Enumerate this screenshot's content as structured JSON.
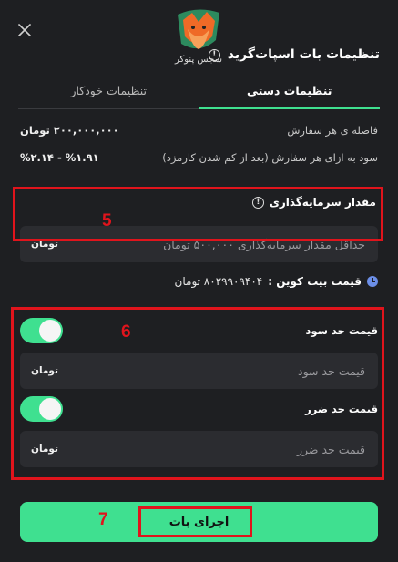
{
  "header": {
    "title": "تنظیمات بات اسپات‌گرید",
    "logo_text": "سجس پنوکر",
    "info_icon": "info-icon",
    "close_icon": "close-icon"
  },
  "tabs": [
    {
      "label": "تنظیمات خودکار",
      "active": false
    },
    {
      "label": "تنظیمات دستی",
      "active": true
    }
  ],
  "info": {
    "order_gap_label": "فاصله ی هر سفارش",
    "order_gap_value": "۲۰۰,۰۰۰,۰۰۰ تومان",
    "profit_label": "سود به ازای هر سفارش (بعد از کم شدن کارمزد)",
    "profit_value": "%۱.۹۱ - %۲.۱۴"
  },
  "investment": {
    "label": "مقدار سرمایه‌گذاری",
    "placeholder": "حداقل مقدار سرمایه‌گذاری ۵۰۰,۰۰۰ تومان",
    "unit": "تومان"
  },
  "bitcoin_price": {
    "label": "قیمت بیت کوین :",
    "value": "۸۰۲۹۹۰۹۴۰۴ تومان"
  },
  "take_profit": {
    "label": "قیمت حد سود",
    "placeholder": "قیمت حد سود",
    "unit": "تومان",
    "enabled": true
  },
  "stop_loss": {
    "label": "قیمت حد ضرر",
    "placeholder": "قیمت حد ضرر",
    "unit": "تومان",
    "enabled": true
  },
  "run_button": {
    "label": "اجرای بات"
  },
  "annotations": {
    "n5": "5",
    "n6": "6",
    "n7": "7"
  },
  "colors": {
    "accent": "#3fe090",
    "annotation": "#e0141c",
    "background": "#1e1f22",
    "input": "#2b2c30"
  }
}
